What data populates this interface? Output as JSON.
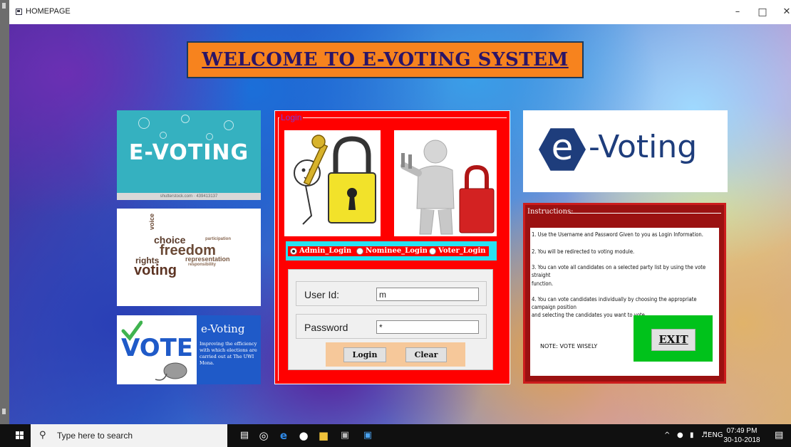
{
  "window": {
    "title": "HOMEPAGE",
    "minimize_glyph": "–",
    "maximize_glyph": "□",
    "close_glyph": "✕"
  },
  "header": {
    "welcome_text": "WELCOME TO E-VOTING SYSTEM"
  },
  "left_images": {
    "evoting_banner_text": "E-VOTING",
    "evoting_banner_credit": "shutterstock.com · 439413137",
    "wordcloud_words": [
      "choice",
      "freedom",
      "representation",
      "rights",
      "voting",
      "participation",
      "responsibility",
      "voice"
    ],
    "vote_card_word": "VOTE",
    "vote_card_title": "e-Voting",
    "vote_card_desc": "Improving the efficiency with which elections are carried out at The UWI Mona."
  },
  "login": {
    "legend": "Login",
    "radios": [
      {
        "label": "Admin_Login",
        "selected": true
      },
      {
        "label": "Nominee_Login",
        "selected": false
      },
      {
        "label": "Voter_Login",
        "selected": false
      }
    ],
    "user_id_label": "User Id:",
    "user_id_value": "m",
    "password_label": "Password",
    "password_value": "*",
    "login_button": "Login",
    "clear_button": "Clear"
  },
  "logo": {
    "e_letter": "e",
    "text": "-Voting"
  },
  "instructions": {
    "legend": "Instructions:",
    "lines": [
      "1. Use the Username and Password Given to you as Login Information.",
      "2. You will be redirected to voting module.",
      "3. You can vote all candidates on a selected party list by using the vote straight",
      "function.",
      "4. You can vote candidates individually by choosing the appropriate campaign position",
      "and selecting the candidates you want to vote."
    ],
    "note": "NOTE: VOTE WISELY",
    "exit_button": "EXIT"
  },
  "taskbar": {
    "search_placeholder": "Type here to search",
    "language": "ENG",
    "time": "07:49 PM",
    "date": "30-10-2018"
  },
  "colors": {
    "welcome_bg": "#f7831e",
    "login_panel": "#ff0000",
    "radio_strip": "#28e2f2",
    "instructions_bg": "#9b1111",
    "exit_bg": "#00c21b"
  }
}
